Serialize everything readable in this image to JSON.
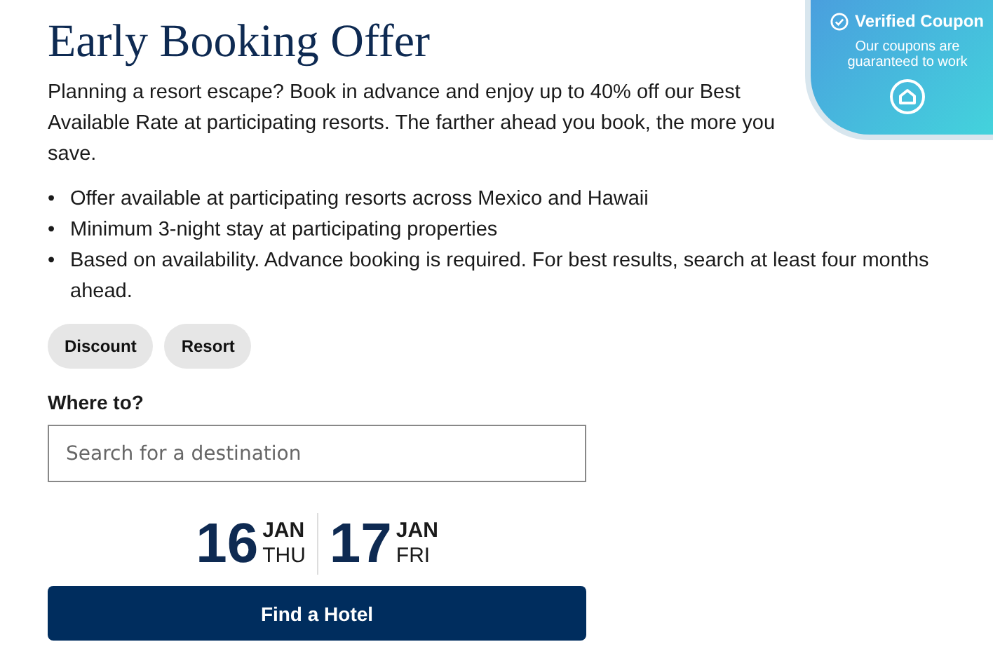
{
  "title": "Early Booking Offer",
  "intro": "Planning a resort escape? Book in advance and enjoy up to 40% off our Best Available Rate at participating resorts. The farther ahead you book, the more you save.",
  "bullets": [
    {
      "marker": "•",
      "text": "Offer available at participating resorts across Mexico and Hawaii"
    },
    {
      "marker": "•",
      "text": "Minimum 3-night stay at participating properties"
    },
    {
      "marker": "•",
      "text": "Based on availability. Advance booking is required. For best results, search at least four months ahead."
    }
  ],
  "tags": [
    "Discount",
    "Resort"
  ],
  "search": {
    "label": "Where to?",
    "placeholder": "Search for a destination"
  },
  "dates": [
    {
      "day": "16",
      "month": "JAN",
      "weekday": "THU"
    },
    {
      "day": "17",
      "month": "JAN",
      "weekday": "FRI"
    }
  ],
  "button": "Find a Hotel",
  "badge": {
    "title": "Verified Coupon",
    "text": "Our coupons are guaranteed to work"
  }
}
